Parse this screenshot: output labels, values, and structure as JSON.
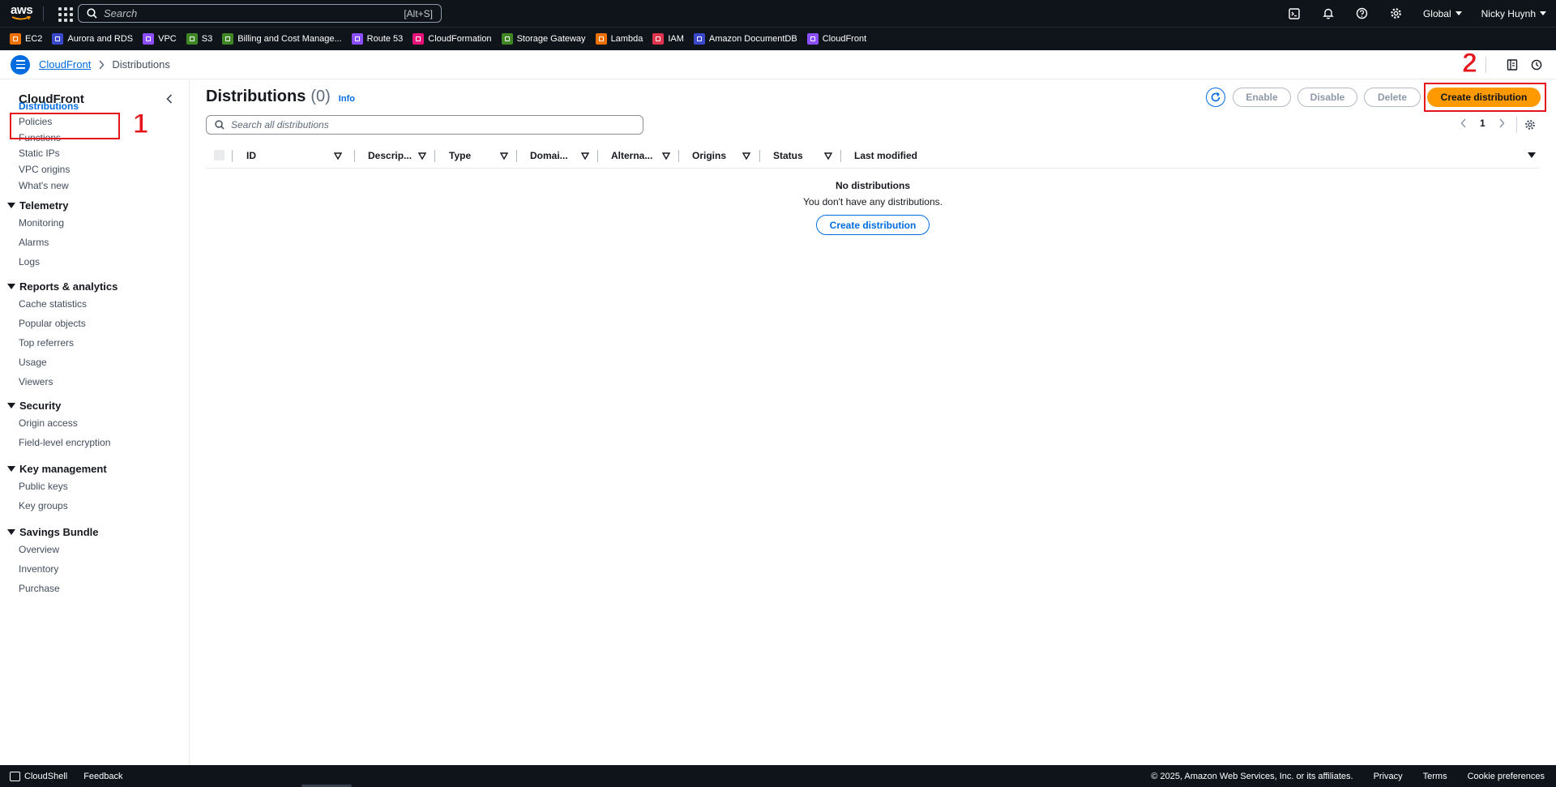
{
  "topnav": {
    "logo": "aws",
    "search_placeholder": "Search",
    "search_shortcut": "[Alt+S]",
    "icons": [
      "cloudshell-icon",
      "bell-icon",
      "help-icon",
      "gear-icon"
    ],
    "region": "Global",
    "user": "Nicky Huynh"
  },
  "favorites": [
    {
      "label": "EC2",
      "color": "#ed7100"
    },
    {
      "label": "Aurora and RDS",
      "color": "#3b48cc"
    },
    {
      "label": "VPC",
      "color": "#8c4fff"
    },
    {
      "label": "S3",
      "color": "#3f8624"
    },
    {
      "label": "Billing and Cost Manage...",
      "color": "#3f8624"
    },
    {
      "label": "Route 53",
      "color": "#8c4fff"
    },
    {
      "label": "CloudFormation",
      "color": "#e7157b"
    },
    {
      "label": "Storage Gateway",
      "color": "#3f8624"
    },
    {
      "label": "Lambda",
      "color": "#ed7100"
    },
    {
      "label": "IAM",
      "color": "#dd344c"
    },
    {
      "label": "Amazon DocumentDB",
      "color": "#3b48cc"
    },
    {
      "label": "CloudFront",
      "color": "#8c4fff"
    }
  ],
  "breadcrumb": {
    "root": "CloudFront",
    "current": "Distributions"
  },
  "sidenav": {
    "title": "CloudFront",
    "items_top": [
      "Distributions",
      "Policies",
      "Functions",
      "Static IPs",
      "VPC origins",
      "What's new"
    ],
    "sections": [
      {
        "title": "Telemetry",
        "items": [
          "Monitoring",
          "Alarms",
          "Logs"
        ]
      },
      {
        "title": "Reports & analytics",
        "items": [
          "Cache statistics",
          "Popular objects",
          "Top referrers",
          "Usage",
          "Viewers"
        ]
      },
      {
        "title": "Security",
        "items": [
          "Origin access",
          "Field-level encryption"
        ]
      },
      {
        "title": "Key management",
        "items": [
          "Public keys",
          "Key groups"
        ]
      },
      {
        "title": "Savings Bundle",
        "items": [
          "Overview",
          "Inventory",
          "Purchase"
        ]
      }
    ]
  },
  "annotations": {
    "one": "1",
    "two": "2"
  },
  "main": {
    "title": "Distributions",
    "count": "(0)",
    "info": "Info",
    "buttons": {
      "enable": "Enable",
      "disable": "Disable",
      "delete": "Delete",
      "create": "Create distribution"
    },
    "search_placeholder": "Search all distributions",
    "page": "1",
    "columns": [
      "ID",
      "Descrip...",
      "Type",
      "Domai...",
      "Alterna...",
      "Origins",
      "Status",
      "Last modified"
    ],
    "empty_title": "No distributions",
    "empty_text": "You don't have any distributions.",
    "empty_button": "Create distribution"
  },
  "footer": {
    "cloudshell": "CloudShell",
    "feedback": "Feedback",
    "copyright": "© 2025, Amazon Web Services, Inc. or its affiliates.",
    "privacy": "Privacy",
    "terms": "Terms",
    "cookies": "Cookie preferences"
  }
}
